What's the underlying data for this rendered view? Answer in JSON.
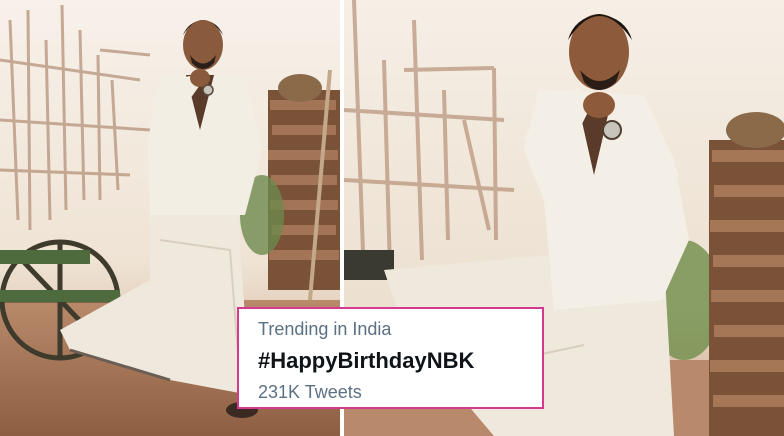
{
  "trend": {
    "context": "Trending in India",
    "hashtag": "#HappyBirthdayNBK",
    "tweet_count": "231K Tweets"
  },
  "colors": {
    "card_border": "#d63a8e",
    "card_background": "#ffffff",
    "hashtag_text": "#0f1419",
    "secondary_text": "#5b7083"
  }
}
